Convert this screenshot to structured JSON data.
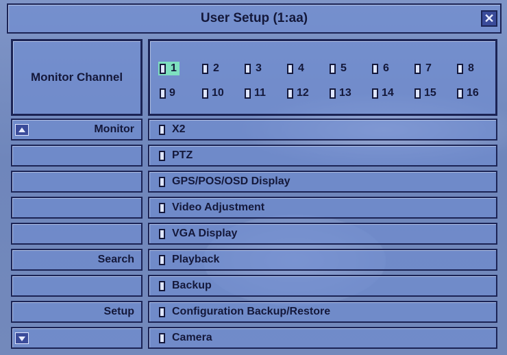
{
  "window": {
    "title": "User Setup (1:aa)",
    "close_label": "✕"
  },
  "monitor_channel": {
    "label": "Monitor Channel",
    "selected": "1",
    "row1": [
      "1",
      "2",
      "3",
      "4",
      "5",
      "6",
      "7",
      "8"
    ],
    "row2": [
      "9",
      "10",
      "11",
      "12",
      "13",
      "14",
      "15",
      "16"
    ]
  },
  "rows": [
    {
      "category": "Monitor",
      "option": "X2"
    },
    {
      "category": "",
      "option": "PTZ"
    },
    {
      "category": "",
      "option": "GPS/POS/OSD Display"
    },
    {
      "category": "",
      "option": "Video Adjustment"
    },
    {
      "category": "",
      "option": "VGA Display"
    },
    {
      "category": "Search",
      "option": "Playback"
    },
    {
      "category": "",
      "option": "Backup"
    },
    {
      "category": "Setup",
      "option": "Configuration Backup/Restore"
    },
    {
      "category": "",
      "option": "Camera"
    }
  ],
  "colors": {
    "highlight": "#7ee0c0",
    "panel": "#708cd2",
    "border": "#1b2354"
  },
  "icons": {
    "close": "close-icon",
    "scroll_up": "scroll-up-icon",
    "scroll_down": "scroll-down-icon"
  }
}
